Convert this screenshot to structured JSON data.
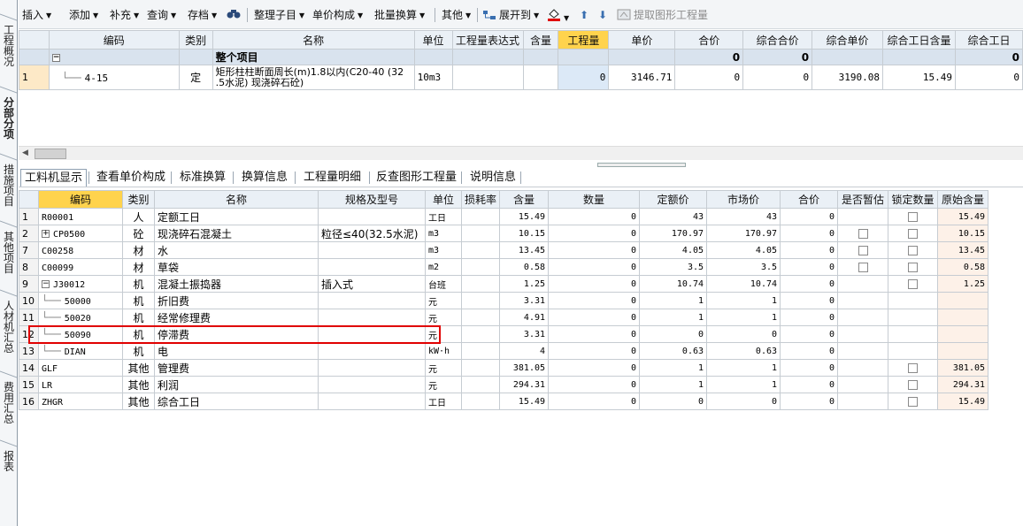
{
  "left_nav": [
    {
      "label": "工程概况",
      "active": false
    },
    {
      "label": "分部分项",
      "active": true
    },
    {
      "label": "措施项目",
      "active": false
    },
    {
      "label": "其他项目",
      "active": false
    },
    {
      "label": "人材机汇总",
      "active": false
    },
    {
      "label": "费用汇总",
      "active": false
    },
    {
      "label": "报表",
      "active": false
    }
  ],
  "toolbar": {
    "insert": "插入",
    "add": "添加",
    "supplement": "补充",
    "query": "查询",
    "save": "存档",
    "organize": "整理子目",
    "price_composition": "单价构成",
    "batch_convert": "批量换算",
    "other": "其他",
    "expand_to": "展开到",
    "extract": "提取图形工程量"
  },
  "top_grid": {
    "headers": [
      "编码",
      "类别",
      "名称",
      "单位",
      "工程量表达式",
      "含量",
      "工程量",
      "单价",
      "合价",
      "综合合价",
      "综合单价",
      "综合工日含量",
      "综合工日"
    ],
    "summary_row": {
      "name": "整个项目",
      "total_price": "0",
      "comp_total": "0",
      "comp_workday": "0"
    },
    "rows": [
      {
        "num": "1",
        "code": "4-15",
        "type": "定",
        "name_line1": "矩形柱柱断面周长(m)1.8以内(C20-40 (32",
        "name_line2": ".5水泥) 现浇碎石砼)",
        "unit": "10m3",
        "expr": "",
        "content": "",
        "quantity": "0",
        "unit_price": "3146.71",
        "total_price": "0",
        "comp_total": "0",
        "comp_unit": "3190.08",
        "comp_workday_content": "15.49",
        "comp_workday": "0"
      }
    ]
  },
  "tabs": [
    "工料机显示",
    "查看单价构成",
    "标准换算",
    "换算信息",
    "工程量明细",
    "反查图形工程量",
    "说明信息"
  ],
  "bottom_grid": {
    "headers": [
      "编码",
      "类别",
      "名称",
      "规格及型号",
      "单位",
      "损耗率",
      "含量",
      "数量",
      "定额价",
      "市场价",
      "合价",
      "是否暂估",
      "锁定数量",
      "原始含量"
    ],
    "rows": [
      {
        "num": "1",
        "tree": "",
        "code": "R00001",
        "type": "人",
        "name": "定额工日",
        "spec": "",
        "unit": "工日",
        "loss": "",
        "content": "15.49",
        "qty": "0",
        "base": "43",
        "market": "43",
        "total": "0",
        "est": false,
        "lock": true,
        "orig": "15.49"
      },
      {
        "num": "2",
        "tree": "plus",
        "code": "CP0500",
        "type": "砼",
        "name": "现浇碎石混凝土",
        "spec": "粒径≤40(32.5水泥)",
        "unit": "m3",
        "loss": "",
        "content": "10.15",
        "qty": "0",
        "base": "170.97",
        "market": "170.97",
        "total": "0",
        "est": true,
        "lock": true,
        "orig": "10.15"
      },
      {
        "num": "7",
        "tree": "",
        "code": "C00258",
        "type": "材",
        "name": "水",
        "spec": "",
        "unit": "m3",
        "loss": "",
        "content": "13.45",
        "qty": "0",
        "base": "4.05",
        "market": "4.05",
        "total": "0",
        "est": true,
        "lock": true,
        "orig": "13.45"
      },
      {
        "num": "8",
        "tree": "",
        "code": "C00099",
        "type": "材",
        "name": "草袋",
        "spec": "",
        "unit": "m2",
        "loss": "",
        "content": "0.58",
        "qty": "0",
        "base": "3.5",
        "market": "3.5",
        "total": "0",
        "est": true,
        "lock": true,
        "orig": "0.58"
      },
      {
        "num": "9",
        "tree": "minus",
        "code": "J30012",
        "type": "机",
        "name": "混凝土振捣器",
        "spec": "插入式",
        "unit": "台班",
        "loss": "",
        "content": "1.25",
        "qty": "0",
        "base": "10.74",
        "market": "10.74",
        "total": "0",
        "est": false,
        "lock": true,
        "orig": "1.25"
      },
      {
        "num": "10",
        "tree": "child",
        "code": "50000",
        "type": "机",
        "name": "折旧费",
        "spec": "",
        "unit": "元",
        "loss": "",
        "content": "3.31",
        "qty": "0",
        "base": "1",
        "market": "1",
        "total": "0",
        "est": false,
        "lock": false,
        "orig": ""
      },
      {
        "num": "11",
        "tree": "child",
        "code": "50020",
        "type": "机",
        "name": "经常修理费",
        "spec": "",
        "unit": "元",
        "loss": "",
        "content": "4.91",
        "qty": "0",
        "base": "1",
        "market": "1",
        "total": "0",
        "est": false,
        "lock": false,
        "orig": ""
      },
      {
        "num": "12",
        "tree": "child",
        "code": "50090",
        "type": "机",
        "name": "停滞费",
        "spec": "",
        "unit": "元",
        "loss": "",
        "content": "3.31",
        "qty": "0",
        "base": "0",
        "market": "0",
        "total": "0",
        "est": false,
        "lock": false,
        "orig": ""
      },
      {
        "num": "13",
        "tree": "child",
        "code": "DIAN",
        "type": "机",
        "name": "电",
        "spec": "",
        "unit": "kW·h",
        "loss": "",
        "content": "4",
        "qty": "0",
        "base": "0.63",
        "market": "0.63",
        "total": "0",
        "est": false,
        "lock": false,
        "orig": ""
      },
      {
        "num": "14",
        "tree": "",
        "code": "GLF",
        "type": "其他",
        "name": "管理费",
        "spec": "",
        "unit": "元",
        "loss": "",
        "content": "381.05",
        "qty": "0",
        "base": "1",
        "market": "1",
        "total": "0",
        "est": false,
        "lock": true,
        "orig": "381.05"
      },
      {
        "num": "15",
        "tree": "",
        "code": "LR",
        "type": "其他",
        "name": "利润",
        "spec": "",
        "unit": "元",
        "loss": "",
        "content": "294.31",
        "qty": "0",
        "base": "1",
        "market": "1",
        "total": "0",
        "est": false,
        "lock": true,
        "orig": "294.31"
      },
      {
        "num": "16",
        "tree": "",
        "code": "ZHGR",
        "type": "其他",
        "name": "综合工日",
        "spec": "",
        "unit": "工日",
        "loss": "",
        "content": "15.49",
        "qty": "0",
        "base": "0",
        "market": "0",
        "total": "0",
        "est": false,
        "lock": true,
        "orig": "15.49"
      }
    ]
  },
  "colors": {
    "header_bg": "#eaf0f6",
    "highlight_header": "#ffd34d",
    "summary_bg": "#d9e3ee",
    "annotation_red": "#e00000"
  }
}
